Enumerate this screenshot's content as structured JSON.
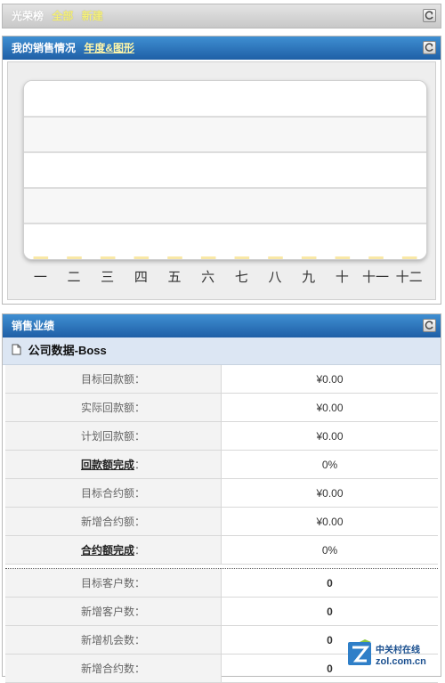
{
  "panel1": {
    "title": "光荣榜",
    "links": [
      "全部",
      "新建"
    ]
  },
  "panel2": {
    "title": "我的销售情况",
    "link": "年度&图形"
  },
  "chart_data": {
    "type": "bar",
    "categories": [
      "一",
      "二",
      "三",
      "四",
      "五",
      "六",
      "七",
      "八",
      "九",
      "十",
      "十一",
      "十二"
    ],
    "values": [
      0,
      0,
      0,
      0,
      0,
      0,
      0,
      0,
      0,
      0,
      0,
      0
    ],
    "title": "",
    "xlabel": "",
    "ylabel": "",
    "grid": true,
    "colors": {
      "bar": "#f5d86a"
    }
  },
  "panel3": {
    "title": "销售业绩",
    "subtitle": "公司数据-Boss",
    "rows": [
      {
        "label": "目标回款额",
        "colon": "：",
        "value": "¥0.00"
      },
      {
        "label": "实际回款额",
        "colon": "：",
        "value": "¥0.00"
      },
      {
        "label": "计划回款额",
        "colon": "：",
        "value": "¥0.00"
      },
      {
        "label": "回款额完成",
        "colon": "：",
        "value": "0%"
      },
      {
        "label": "目标合约额",
        "colon": "：",
        "value": "¥0.00"
      },
      {
        "label": "新增合约额",
        "colon": "：",
        "value": "¥0.00"
      },
      {
        "label": "合约额完成",
        "colon": "：",
        "value": "0%"
      },
      {
        "label": "目标客户数",
        "colon": "：",
        "value": "0"
      },
      {
        "label": "新增客户数",
        "colon": "：",
        "value": "0"
      },
      {
        "label": "新增机会数",
        "colon": "：",
        "value": "0"
      },
      {
        "label": "新增合约数",
        "colon": "：",
        "value": "0"
      }
    ]
  },
  "watermark": {
    "brand": "中关村在线",
    "url": "zol.com.cn"
  },
  "colors": {
    "accent_blue": "#2a6db8",
    "link_yellow": "#fff6a8",
    "value_blue": "#4a7fc0"
  }
}
